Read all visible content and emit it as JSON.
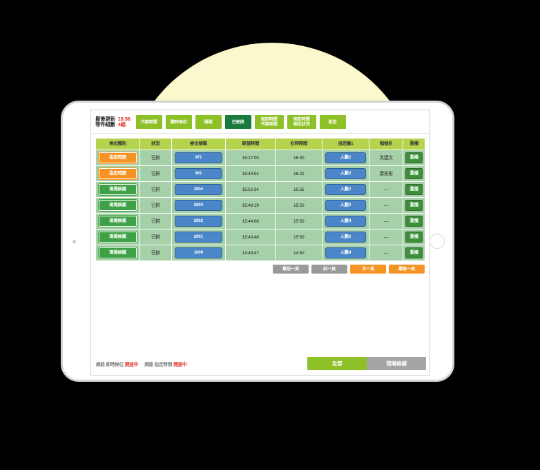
{
  "topbar": {
    "status_label_line1": "最後更新",
    "status_label_line2": "等件組數",
    "status_value_line1": "16:56",
    "status_value_line2": "4組",
    "tabs": [
      {
        "label": "代客取號",
        "line2": "",
        "active": false
      },
      {
        "label": "隨時候位",
        "line2": "",
        "active": false
      },
      {
        "label": "過號",
        "line2": "",
        "active": false
      },
      {
        "label": "已安排",
        "line2": "",
        "active": true
      },
      {
        "label": "指定時間",
        "line2": "代客取號",
        "active": false
      },
      {
        "label": "指定時間",
        "line2": "候位狀況",
        "active": false
      },
      {
        "label": "設定",
        "line2": "",
        "active": false
      }
    ]
  },
  "table": {
    "headers": [
      "候位類別",
      "狀況",
      "候位號碼",
      "取號時間",
      "右時時間",
      "自定義1",
      "唱號名",
      "重播"
    ],
    "rows": [
      {
        "type": "指定時間",
        "type_style": "orange",
        "state": "已排",
        "number": "471",
        "take_time": "15:27:00",
        "appt_time": "16:30",
        "custom1": "人數2",
        "call_name": "洪建文",
        "replay": "重播"
      },
      {
        "type": "指定時間",
        "type_style": "orange",
        "state": "已排",
        "number": "461",
        "take_time": "15:44:54",
        "appt_time": "16:22",
        "custom1": "人數3",
        "call_name": "康安彤",
        "replay": "重播"
      },
      {
        "type": "現場候補",
        "type_style": "green",
        "state": "已排",
        "number": "2004",
        "take_time": "15:52:34",
        "appt_time": "15:55",
        "custom1": "人數2",
        "call_name": "—",
        "replay": "重播"
      },
      {
        "type": "現場候補",
        "type_style": "green",
        "state": "已排",
        "number": "2003",
        "take_time": "15:49:19",
        "appt_time": "15:50",
        "custom1": "人數2",
        "call_name": "—",
        "replay": "重播"
      },
      {
        "type": "現場候補",
        "type_style": "green",
        "state": "已排",
        "number": "2002",
        "take_time": "15:44:08",
        "appt_time": "15:50",
        "custom1": "人數4",
        "call_name": "—",
        "replay": "重播"
      },
      {
        "type": "現場候補",
        "type_style": "green",
        "state": "已排",
        "number": "2001",
        "take_time": "15:43:48",
        "appt_time": "15:50",
        "custom1": "人數2",
        "call_name": "—",
        "replay": "重播"
      },
      {
        "type": "現場候補",
        "type_style": "green",
        "state": "已排",
        "number": "1009",
        "take_time": "14:49:47",
        "appt_time": "14:50",
        "custom1": "人數4",
        "call_name": "—",
        "replay": "重播"
      }
    ]
  },
  "pagination": {
    "first": "最前一頁",
    "prev": "前一頁",
    "next": "次一頁",
    "last": "最後一頁"
  },
  "bottombar": {
    "net1_prefix": "網路 即時候位",
    "net1_state": "開放中",
    "net2_prefix": "網路 指定時間",
    "net2_state": "開放中",
    "filter_all": "全部",
    "filter_onsite": "現場候補"
  },
  "colors": {
    "brand_green": "#8ec127",
    "active_tab_green": "#187a3c",
    "header_green": "#b5d44e",
    "row_green": "#a5d0a8",
    "orange": "#f59425",
    "blue": "#4a86c8",
    "alert_red": "#e2281d",
    "grey": "#9a9a9a",
    "backdrop_yellow": "#fbf8cd"
  }
}
